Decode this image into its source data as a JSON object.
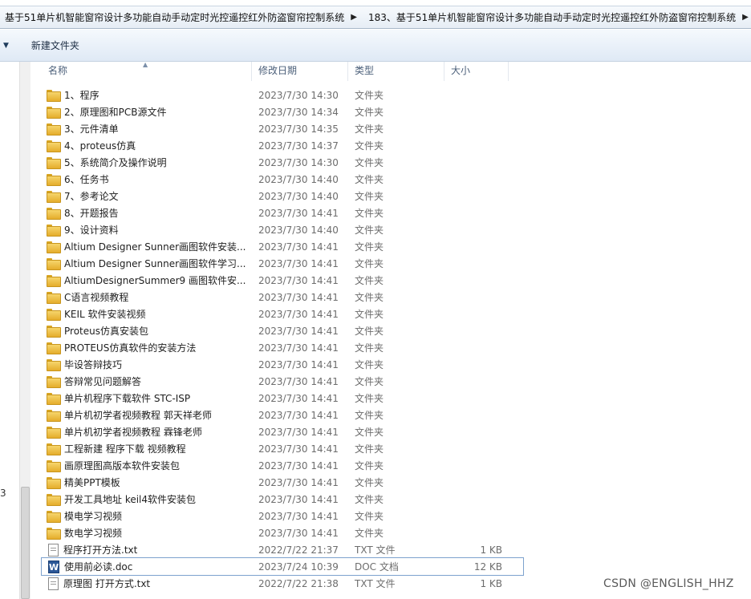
{
  "breadcrumb": [
    "基于51单片机智能窗帘设计多功能自动手动定时光控遥控红外防盗窗帘控制系统",
    "183、基于51单片机智能窗帘设计多功能自动手动定时光控遥控红外防盗窗帘控制系统"
  ],
  "toolbar": {
    "new_folder_label": "新建文件夹"
  },
  "left_pane_digit": "3",
  "columns": {
    "name": "名称",
    "date": "修改日期",
    "type": "类型",
    "size": "大小"
  },
  "files": [
    {
      "name": "1、程序",
      "date": "2023/7/30 14:30",
      "type": "文件夹",
      "size": "",
      "icon": "folder-icon"
    },
    {
      "name": "2、原理图和PCB源文件",
      "date": "2023/7/30 14:34",
      "type": "文件夹",
      "size": "",
      "icon": "folder-icon"
    },
    {
      "name": "3、元件清单",
      "date": "2023/7/30 14:35",
      "type": "文件夹",
      "size": "",
      "icon": "folder-icon"
    },
    {
      "name": "4、proteus仿真",
      "date": "2023/7/30 14:37",
      "type": "文件夹",
      "size": "",
      "icon": "folder-icon"
    },
    {
      "name": "5、系统简介及操作说明",
      "date": "2023/7/30 14:30",
      "type": "文件夹",
      "size": "",
      "icon": "folder-icon"
    },
    {
      "name": "6、任务书",
      "date": "2023/7/30 14:40",
      "type": "文件夹",
      "size": "",
      "icon": "folder-icon"
    },
    {
      "name": "7、参考论文",
      "date": "2023/7/30 14:40",
      "type": "文件夹",
      "size": "",
      "icon": "folder-icon"
    },
    {
      "name": "8、开题报告",
      "date": "2023/7/30 14:41",
      "type": "文件夹",
      "size": "",
      "icon": "folder-icon"
    },
    {
      "name": "9、设计资料",
      "date": "2023/7/30 14:40",
      "type": "文件夹",
      "size": "",
      "icon": "folder-icon"
    },
    {
      "name": "Altium Designer Sunner画图软件安装...",
      "date": "2023/7/30 14:41",
      "type": "文件夹",
      "size": "",
      "icon": "folder-icon"
    },
    {
      "name": "Altium Designer Sunner画图软件学习...",
      "date": "2023/7/30 14:41",
      "type": "文件夹",
      "size": "",
      "icon": "folder-icon"
    },
    {
      "name": "AltiumDesignerSummer9 画图软件安...",
      "date": "2023/7/30 14:41",
      "type": "文件夹",
      "size": "",
      "icon": "folder-icon"
    },
    {
      "name": "C语言视频教程",
      "date": "2023/7/30 14:41",
      "type": "文件夹",
      "size": "",
      "icon": "folder-icon"
    },
    {
      "name": "KEIL 软件安装视频",
      "date": "2023/7/30 14:41",
      "type": "文件夹",
      "size": "",
      "icon": "folder-icon"
    },
    {
      "name": "Proteus仿真安装包",
      "date": "2023/7/30 14:41",
      "type": "文件夹",
      "size": "",
      "icon": "folder-icon"
    },
    {
      "name": "PROTEUS仿真软件的安装方法",
      "date": "2023/7/30 14:41",
      "type": "文件夹",
      "size": "",
      "icon": "folder-icon"
    },
    {
      "name": "毕设答辩技巧",
      "date": "2023/7/30 14:41",
      "type": "文件夹",
      "size": "",
      "icon": "folder-icon"
    },
    {
      "name": "答辩常见问题解答",
      "date": "2023/7/30 14:41",
      "type": "文件夹",
      "size": "",
      "icon": "folder-icon"
    },
    {
      "name": "单片机程序下载软件 STC-ISP",
      "date": "2023/7/30 14:41",
      "type": "文件夹",
      "size": "",
      "icon": "folder-icon"
    },
    {
      "name": "单片机初学者视频教程 郭天祥老师",
      "date": "2023/7/30 14:41",
      "type": "文件夹",
      "size": "",
      "icon": "folder-icon"
    },
    {
      "name": "单片机初学者视频教程 霖锋老师",
      "date": "2023/7/30 14:41",
      "type": "文件夹",
      "size": "",
      "icon": "folder-icon"
    },
    {
      "name": "工程新建  程序下载 视频教程",
      "date": "2023/7/30 14:41",
      "type": "文件夹",
      "size": "",
      "icon": "folder-icon"
    },
    {
      "name": "画原理图高版本软件安装包",
      "date": "2023/7/30 14:41",
      "type": "文件夹",
      "size": "",
      "icon": "folder-icon"
    },
    {
      "name": "精美PPT模板",
      "date": "2023/7/30 14:41",
      "type": "文件夹",
      "size": "",
      "icon": "folder-icon"
    },
    {
      "name": "开发工具地址 keil4软件安装包",
      "date": "2023/7/30 14:41",
      "type": "文件夹",
      "size": "",
      "icon": "folder-icon"
    },
    {
      "name": "模电学习视频",
      "date": "2023/7/30 14:41",
      "type": "文件夹",
      "size": "",
      "icon": "folder-icon"
    },
    {
      "name": "数电学习视频",
      "date": "2023/7/30 14:41",
      "type": "文件夹",
      "size": "",
      "icon": "folder-icon"
    },
    {
      "name": "程序打开方法.txt",
      "date": "2022/7/22 21:37",
      "type": "TXT 文件",
      "size": "1 KB",
      "icon": "txt-file-icon"
    },
    {
      "name": "使用前必读.doc",
      "date": "2023/7/24 10:39",
      "type": "DOC 文档",
      "size": "12 KB",
      "icon": "word-doc-icon",
      "selected": true
    },
    {
      "name": "原理图 打开方式.txt",
      "date": "2022/7/22 21:38",
      "type": "TXT 文件",
      "size": "1 KB",
      "icon": "txt-file-icon"
    }
  ],
  "watermark": "CSDN @ENGLISH_HHZ"
}
